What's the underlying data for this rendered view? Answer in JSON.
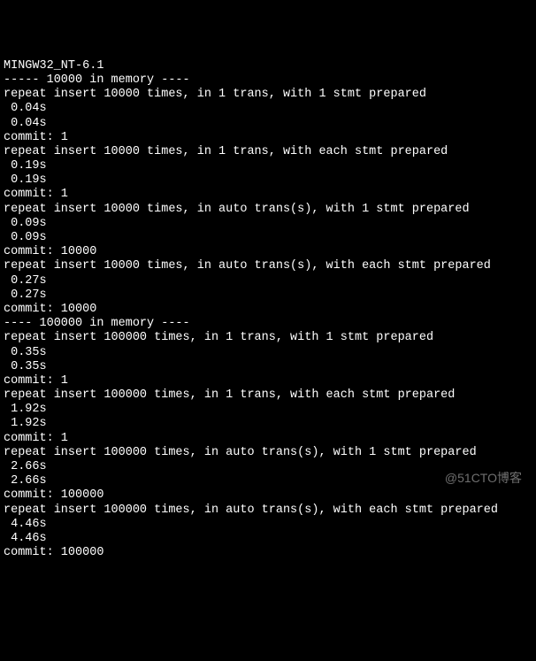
{
  "terminal": {
    "lines": [
      "MINGW32_NT-6.1",
      "----- 10000 in memory ----",
      "repeat insert 10000 times, in 1 trans, with 1 stmt prepared",
      " 0.04s",
      " 0.04s",
      "commit: 1",
      "repeat insert 10000 times, in 1 trans, with each stmt prepared",
      " 0.19s",
      " 0.19s",
      "commit: 1",
      "repeat insert 10000 times, in auto trans(s), with 1 stmt prepared",
      " 0.09s",
      " 0.09s",
      "commit: 10000",
      "repeat insert 10000 times, in auto trans(s), with each stmt prepared",
      " 0.27s",
      " 0.27s",
      "commit: 10000",
      "---- 100000 in memory ----",
      "repeat insert 100000 times, in 1 trans, with 1 stmt prepared",
      " 0.35s",
      " 0.35s",
      "commit: 1",
      "repeat insert 100000 times, in 1 trans, with each stmt prepared",
      " 1.92s",
      " 1.92s",
      "commit: 1",
      "repeat insert 100000 times, in auto trans(s), with 1 stmt prepared",
      " 2.66s",
      " 2.66s",
      "commit: 100000",
      "repeat insert 100000 times, in auto trans(s), with each stmt prepared",
      " 4.46s",
      " 4.46s",
      "commit: 100000"
    ]
  },
  "watermark": "@51CTO博客"
}
